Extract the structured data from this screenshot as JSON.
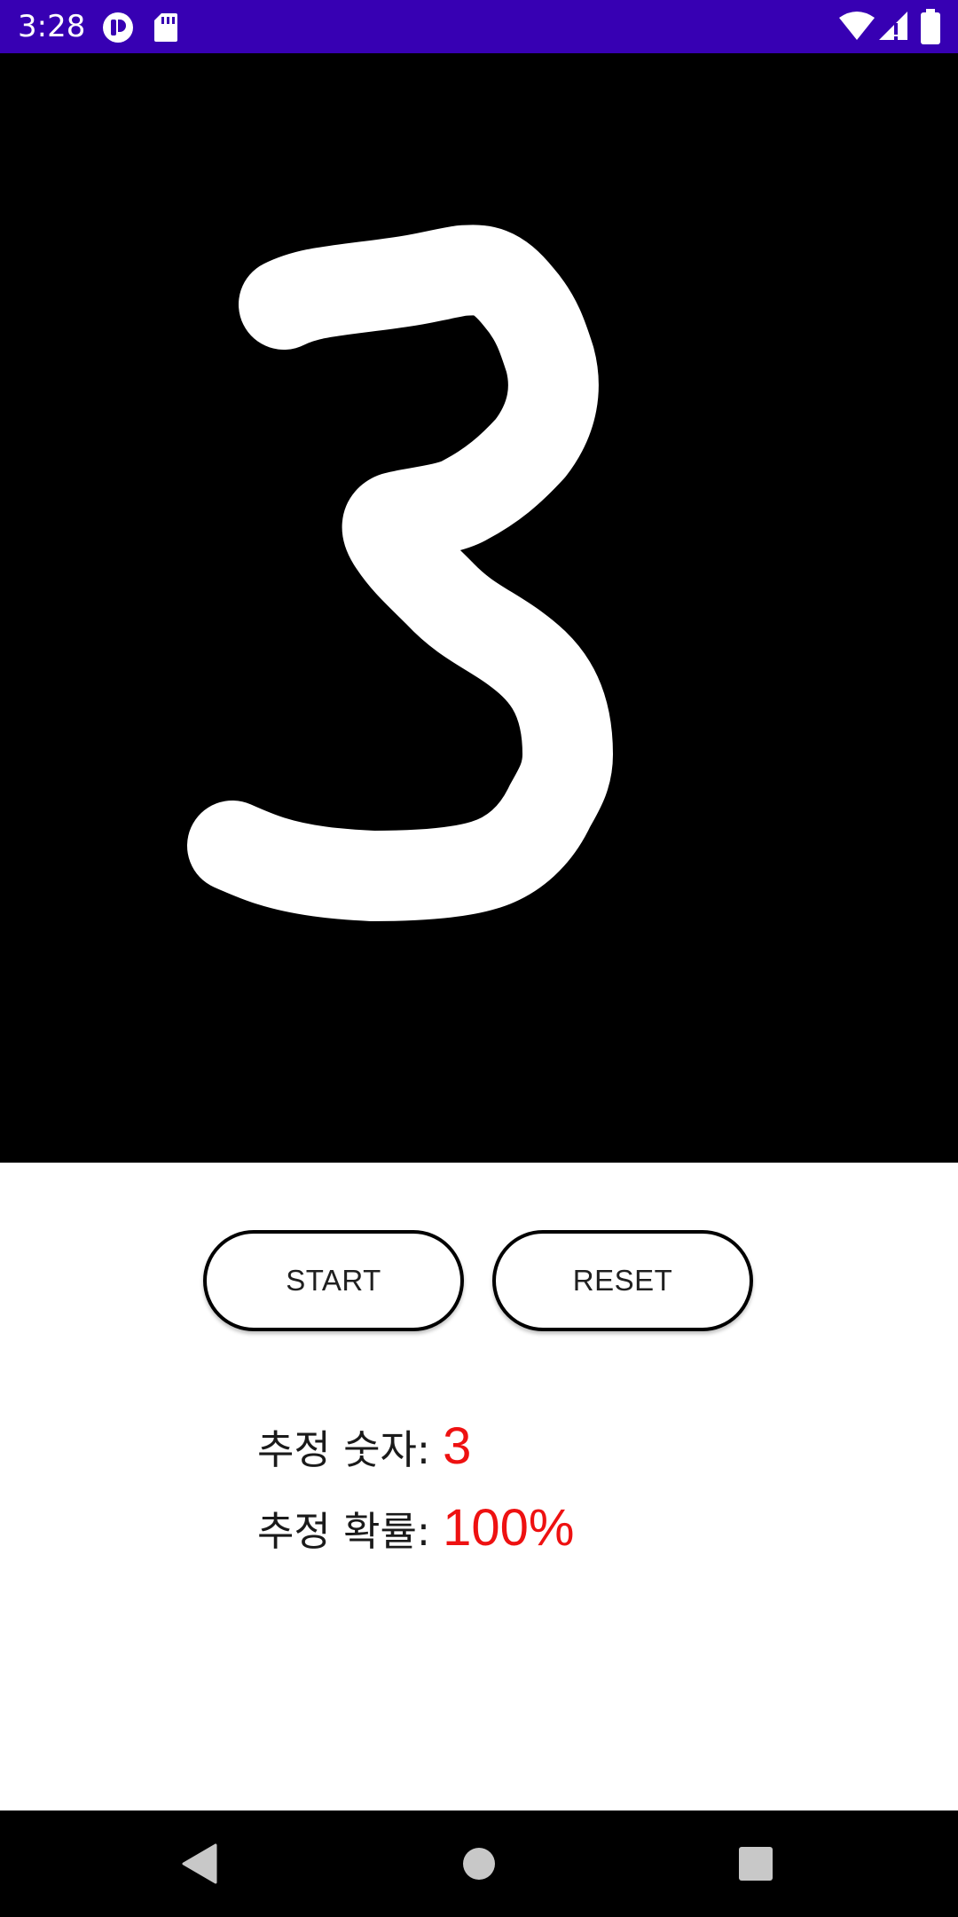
{
  "status_bar": {
    "time": "3:28",
    "icons": [
      "app-notification-icon",
      "sd-card-icon",
      "wifi-icon",
      "cell-signal-icon",
      "battery-icon"
    ]
  },
  "canvas": {
    "background": "#000000",
    "stroke_color": "#ffffff"
  },
  "controls": {
    "start_label": "START",
    "reset_label": "RESET"
  },
  "result": {
    "digit_label": "추정 숫자:",
    "digit_value": "3",
    "probability_label": "추정 확률:",
    "probability_value": "100%",
    "value_color": "#ee1111"
  },
  "nav_bar": {
    "icons": [
      "back-icon",
      "home-icon",
      "recents-icon"
    ]
  },
  "colors": {
    "status_bar": "#3700b3",
    "nav_bar": "#000000"
  }
}
